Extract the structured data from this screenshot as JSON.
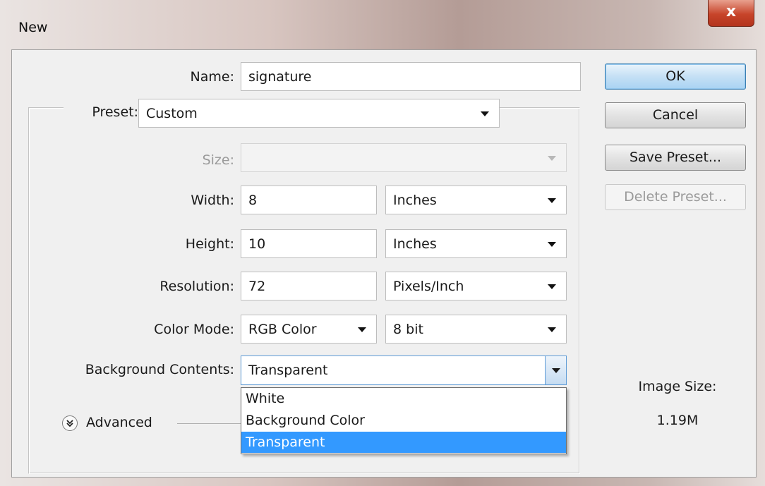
{
  "window": {
    "title": "New",
    "close_glyph": "x"
  },
  "form": {
    "name": {
      "label": "Name:",
      "value": "signature"
    },
    "preset": {
      "label": "Preset:",
      "value": "Custom"
    },
    "size": {
      "label": "Size:",
      "value": ""
    },
    "width": {
      "label": "Width:",
      "value": "8",
      "unit": "Inches"
    },
    "height": {
      "label": "Height:",
      "value": "10",
      "unit": "Inches"
    },
    "resolution": {
      "label": "Resolution:",
      "value": "72",
      "unit": "Pixels/Inch"
    },
    "color_mode": {
      "label": "Color Mode:",
      "value": "RGB Color",
      "depth": "8 bit"
    },
    "background": {
      "label": "Background Contents:",
      "value": "Transparent",
      "options": [
        "White",
        "Background Color",
        "Transparent"
      ],
      "selected_index": 2
    },
    "advanced": {
      "label": "Advanced",
      "icon": "chevron-double-down-icon"
    }
  },
  "buttons": {
    "ok": "OK",
    "cancel": "Cancel",
    "save_preset": "Save Preset...",
    "delete_preset": "Delete Preset..."
  },
  "image_size": {
    "label": "Image Size:",
    "value": "1.19M"
  },
  "colors": {
    "accent": "#3399ff",
    "close": "#c7442a"
  }
}
